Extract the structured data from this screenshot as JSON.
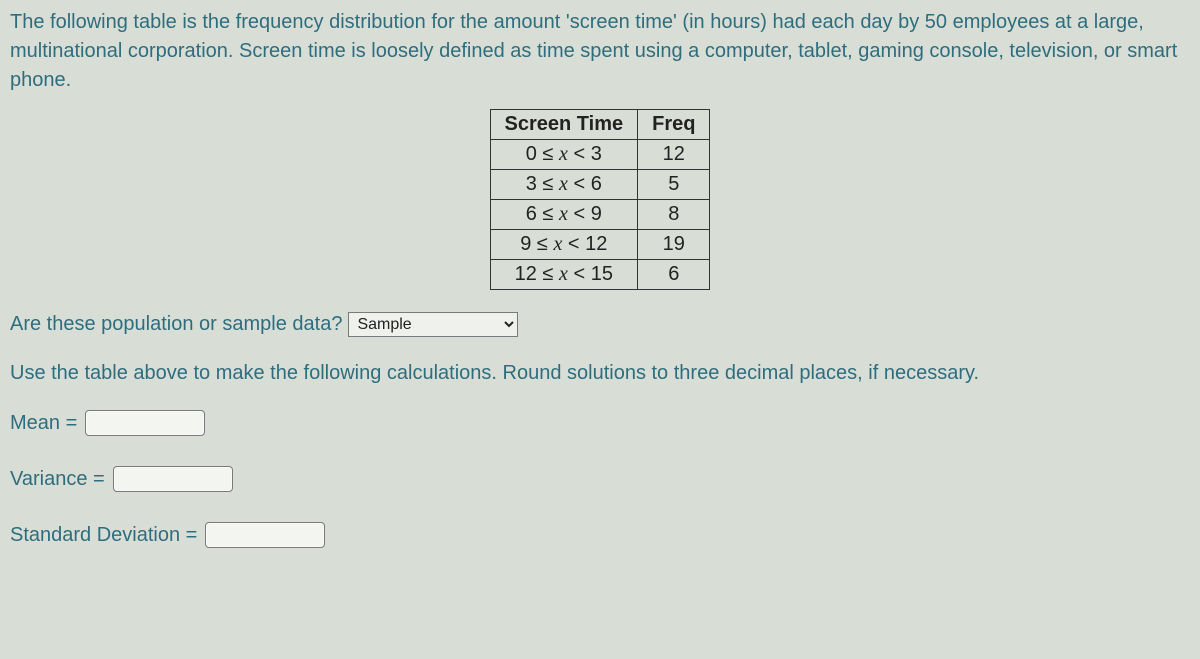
{
  "intro_text": "The following table is the frequency distribution for the amount 'screen time' (in hours) had each day by 50 employees at a large, multinational corporation. Screen time is loosely defined as time spent using a computer, tablet, gaming console, television, or smart phone.",
  "table": {
    "headers": {
      "col1": "Screen Time",
      "col2": "Freq"
    },
    "rows": [
      {
        "interval_low": "0",
        "interval_high": "3",
        "freq": "12"
      },
      {
        "interval_low": "3",
        "interval_high": "6",
        "freq": "5"
      },
      {
        "interval_low": "6",
        "interval_high": "9",
        "freq": "8"
      },
      {
        "interval_low": "9",
        "interval_high": "12",
        "freq": "19"
      },
      {
        "interval_low": "12",
        "interval_high": "15",
        "freq": "6"
      }
    ]
  },
  "question1": {
    "prompt": "Are these population or sample data?",
    "selected": "Sample"
  },
  "instructions": "Use the table above to make the following calculations. Round solutions to three decimal places, if necessary.",
  "answers": {
    "mean_label": "Mean =",
    "variance_label": "Variance =",
    "std_label": "Standard Deviation ="
  },
  "symbols": {
    "leq": "≤",
    "lt": "<",
    "x": "x"
  }
}
